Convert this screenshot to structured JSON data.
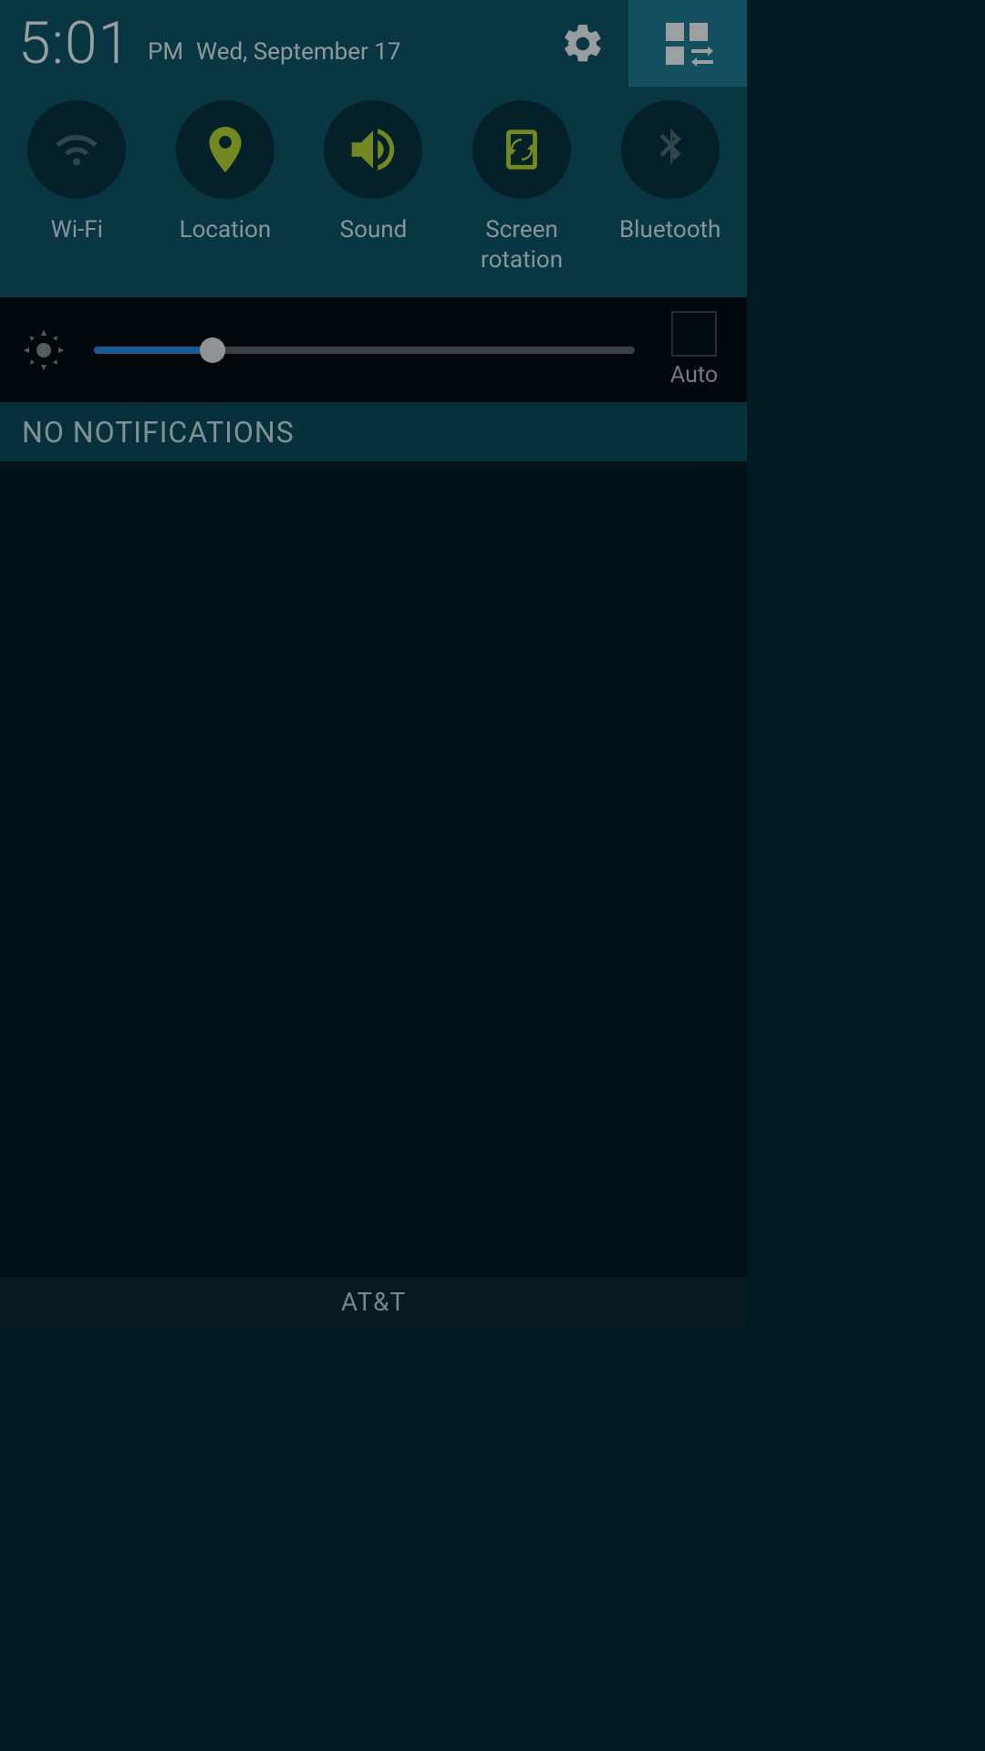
{
  "header": {
    "time": "5:01",
    "ampm": "PM",
    "date": "Wed, September 17"
  },
  "toggles": [
    {
      "id": "wifi",
      "label": "Wi-Fi",
      "active": false
    },
    {
      "id": "location",
      "label": "Location",
      "active": true
    },
    {
      "id": "sound",
      "label": "Sound",
      "active": true
    },
    {
      "id": "screen_rotation",
      "label": "Screen\nrotation",
      "active": true
    },
    {
      "id": "bluetooth",
      "label": "Bluetooth",
      "active": false
    }
  ],
  "brightness": {
    "percent": 22,
    "auto_label": "Auto",
    "auto_checked": false
  },
  "notifications": {
    "empty_label": "NO NOTIFICATIONS"
  },
  "footer": {
    "carrier": "AT&T"
  },
  "colors": {
    "active_icon": "#b2d235",
    "inactive_icon": "#4a6a72",
    "header_bg": "#0e5368",
    "accent_slider": "#2a8de0"
  }
}
